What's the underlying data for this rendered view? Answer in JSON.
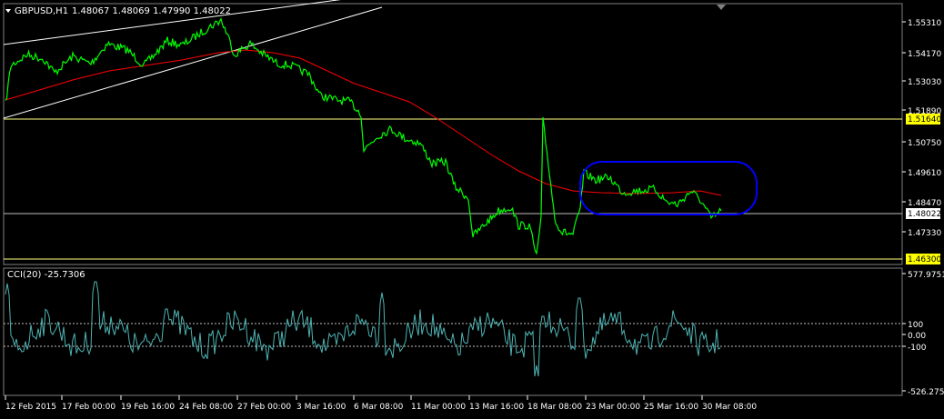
{
  "main_panel": {
    "symbol_label": "GBPUSD,H1",
    "ohlc_label": "1.48067 1.48069 1.47990 1.48022",
    "y_ticks": [
      "1.55310",
      "1.54170",
      "1.53030",
      "1.51890",
      "1.50750",
      "1.49610",
      "1.48470",
      "1.47330"
    ],
    "level_labels": [
      {
        "text": "1.51640",
        "style": "yellow"
      },
      {
        "text": "1.48022",
        "style": "white"
      },
      {
        "text": "1.46300",
        "style": "yellow"
      }
    ]
  },
  "cci_panel": {
    "label": "CCI(20) -25.7306",
    "y_ticks": [
      "577.9751",
      "100",
      "0.00",
      "-100",
      "-526.2753"
    ]
  },
  "x_axis": {
    "labels": [
      "12 Feb 2015",
      "17 Feb 00:00",
      "19 Feb 16:00",
      "24 Feb 08:00",
      "27 Feb 00:00",
      "3 Mar 16:00",
      "6 Mar 08:00",
      "11 Mar 00:00",
      "13 Mar 16:00",
      "18 Mar 08:00",
      "23 Mar 00:00",
      "25 Mar 16:00",
      "30 Mar 08:00"
    ]
  },
  "colors": {
    "background": "#000000",
    "price_line": "#00ff00",
    "moving_average": "#ff0000",
    "channel_lines": "#ffffff",
    "horizontal_lines": "#ffff80",
    "cci_line": "#4fb3b3",
    "annotation": "#0000ff",
    "axis_text": "#ffffff",
    "level_box_yellow": "#ffff00"
  },
  "icons": {
    "menu": "triangle-down-icon",
    "shift": "chart-shift-marker-icon"
  }
}
